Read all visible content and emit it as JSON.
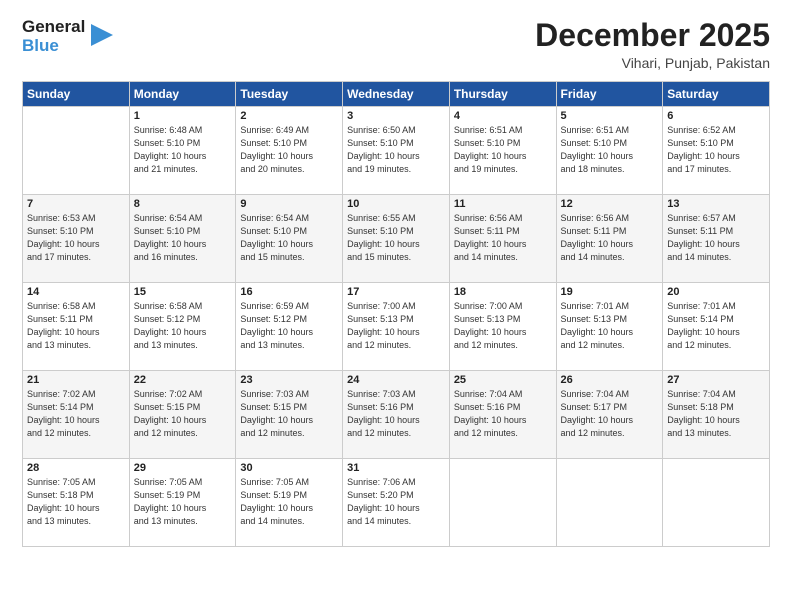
{
  "logo": {
    "text1": "General",
    "text2": "Blue"
  },
  "title": "December 2025",
  "subtitle": "Vihari, Punjab, Pakistan",
  "header_days": [
    "Sunday",
    "Monday",
    "Tuesday",
    "Wednesday",
    "Thursday",
    "Friday",
    "Saturday"
  ],
  "weeks": [
    [
      {
        "day": "",
        "info": ""
      },
      {
        "day": "1",
        "info": "Sunrise: 6:48 AM\nSunset: 5:10 PM\nDaylight: 10 hours\nand 21 minutes."
      },
      {
        "day": "2",
        "info": "Sunrise: 6:49 AM\nSunset: 5:10 PM\nDaylight: 10 hours\nand 20 minutes."
      },
      {
        "day": "3",
        "info": "Sunrise: 6:50 AM\nSunset: 5:10 PM\nDaylight: 10 hours\nand 19 minutes."
      },
      {
        "day": "4",
        "info": "Sunrise: 6:51 AM\nSunset: 5:10 PM\nDaylight: 10 hours\nand 19 minutes."
      },
      {
        "day": "5",
        "info": "Sunrise: 6:51 AM\nSunset: 5:10 PM\nDaylight: 10 hours\nand 18 minutes."
      },
      {
        "day": "6",
        "info": "Sunrise: 6:52 AM\nSunset: 5:10 PM\nDaylight: 10 hours\nand 17 minutes."
      }
    ],
    [
      {
        "day": "7",
        "info": "Sunrise: 6:53 AM\nSunset: 5:10 PM\nDaylight: 10 hours\nand 17 minutes."
      },
      {
        "day": "8",
        "info": "Sunrise: 6:54 AM\nSunset: 5:10 PM\nDaylight: 10 hours\nand 16 minutes."
      },
      {
        "day": "9",
        "info": "Sunrise: 6:54 AM\nSunset: 5:10 PM\nDaylight: 10 hours\nand 15 minutes."
      },
      {
        "day": "10",
        "info": "Sunrise: 6:55 AM\nSunset: 5:10 PM\nDaylight: 10 hours\nand 15 minutes."
      },
      {
        "day": "11",
        "info": "Sunrise: 6:56 AM\nSunset: 5:11 PM\nDaylight: 10 hours\nand 14 minutes."
      },
      {
        "day": "12",
        "info": "Sunrise: 6:56 AM\nSunset: 5:11 PM\nDaylight: 10 hours\nand 14 minutes."
      },
      {
        "day": "13",
        "info": "Sunrise: 6:57 AM\nSunset: 5:11 PM\nDaylight: 10 hours\nand 14 minutes."
      }
    ],
    [
      {
        "day": "14",
        "info": "Sunrise: 6:58 AM\nSunset: 5:11 PM\nDaylight: 10 hours\nand 13 minutes."
      },
      {
        "day": "15",
        "info": "Sunrise: 6:58 AM\nSunset: 5:12 PM\nDaylight: 10 hours\nand 13 minutes."
      },
      {
        "day": "16",
        "info": "Sunrise: 6:59 AM\nSunset: 5:12 PM\nDaylight: 10 hours\nand 13 minutes."
      },
      {
        "day": "17",
        "info": "Sunrise: 7:00 AM\nSunset: 5:13 PM\nDaylight: 10 hours\nand 12 minutes."
      },
      {
        "day": "18",
        "info": "Sunrise: 7:00 AM\nSunset: 5:13 PM\nDaylight: 10 hours\nand 12 minutes."
      },
      {
        "day": "19",
        "info": "Sunrise: 7:01 AM\nSunset: 5:13 PM\nDaylight: 10 hours\nand 12 minutes."
      },
      {
        "day": "20",
        "info": "Sunrise: 7:01 AM\nSunset: 5:14 PM\nDaylight: 10 hours\nand 12 minutes."
      }
    ],
    [
      {
        "day": "21",
        "info": "Sunrise: 7:02 AM\nSunset: 5:14 PM\nDaylight: 10 hours\nand 12 minutes."
      },
      {
        "day": "22",
        "info": "Sunrise: 7:02 AM\nSunset: 5:15 PM\nDaylight: 10 hours\nand 12 minutes."
      },
      {
        "day": "23",
        "info": "Sunrise: 7:03 AM\nSunset: 5:15 PM\nDaylight: 10 hours\nand 12 minutes."
      },
      {
        "day": "24",
        "info": "Sunrise: 7:03 AM\nSunset: 5:16 PM\nDaylight: 10 hours\nand 12 minutes."
      },
      {
        "day": "25",
        "info": "Sunrise: 7:04 AM\nSunset: 5:16 PM\nDaylight: 10 hours\nand 12 minutes."
      },
      {
        "day": "26",
        "info": "Sunrise: 7:04 AM\nSunset: 5:17 PM\nDaylight: 10 hours\nand 12 minutes."
      },
      {
        "day": "27",
        "info": "Sunrise: 7:04 AM\nSunset: 5:18 PM\nDaylight: 10 hours\nand 13 minutes."
      }
    ],
    [
      {
        "day": "28",
        "info": "Sunrise: 7:05 AM\nSunset: 5:18 PM\nDaylight: 10 hours\nand 13 minutes."
      },
      {
        "day": "29",
        "info": "Sunrise: 7:05 AM\nSunset: 5:19 PM\nDaylight: 10 hours\nand 13 minutes."
      },
      {
        "day": "30",
        "info": "Sunrise: 7:05 AM\nSunset: 5:19 PM\nDaylight: 10 hours\nand 14 minutes."
      },
      {
        "day": "31",
        "info": "Sunrise: 7:06 AM\nSunset: 5:20 PM\nDaylight: 10 hours\nand 14 minutes."
      },
      {
        "day": "",
        "info": ""
      },
      {
        "day": "",
        "info": ""
      },
      {
        "day": "",
        "info": ""
      }
    ]
  ]
}
